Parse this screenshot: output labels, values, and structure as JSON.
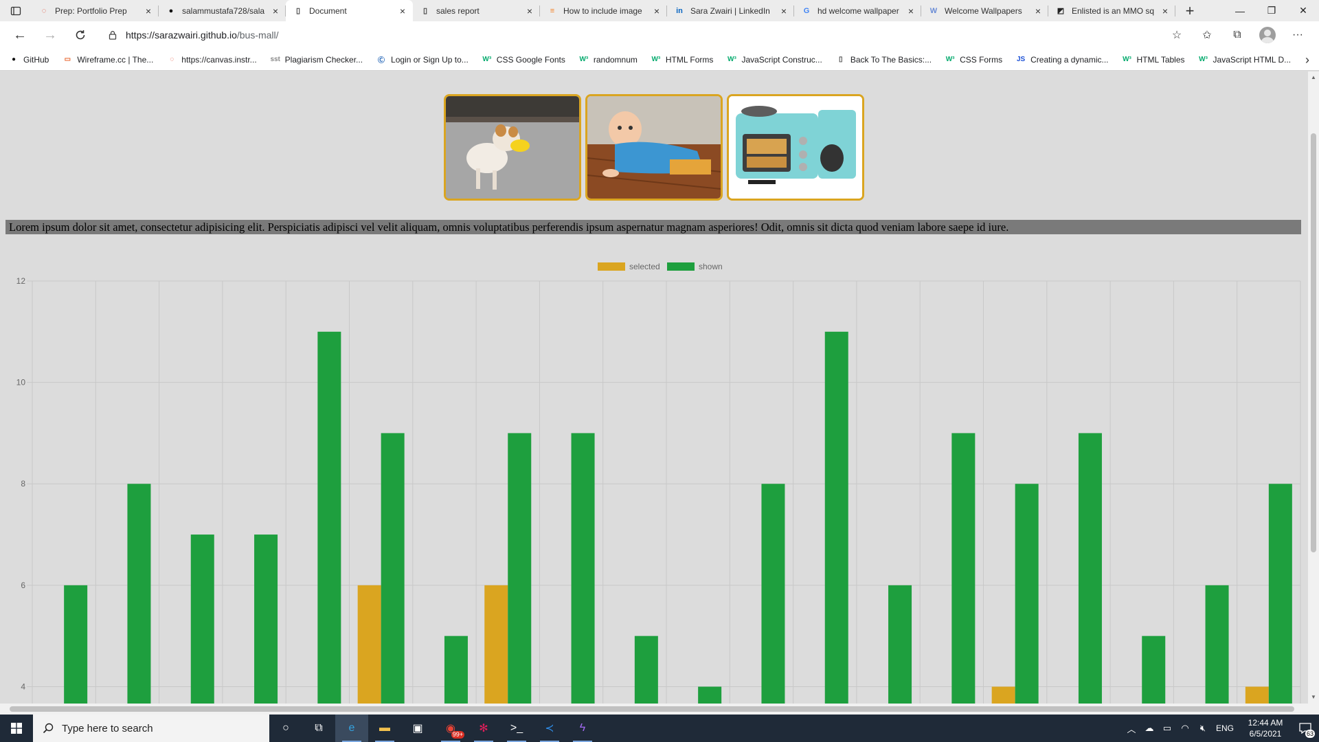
{
  "browser": {
    "tabs": [
      {
        "title": "Prep: Portfolio Prep",
        "icon": "canvas-icon",
        "active": false
      },
      {
        "title": "salammustafa728/sala",
        "icon": "github-icon",
        "active": false
      },
      {
        "title": "Document",
        "icon": "document-icon",
        "active": true
      },
      {
        "title": "sales report",
        "icon": "document-icon",
        "active": false
      },
      {
        "title": "How to include image",
        "icon": "stackoverflow-icon",
        "active": false
      },
      {
        "title": "Sara Zwairi | LinkedIn",
        "icon": "linkedin-icon",
        "active": false
      },
      {
        "title": "hd welcome wallpaper",
        "icon": "google-icon",
        "active": false
      },
      {
        "title": "Welcome Wallpapers",
        "icon": "wallpapers-icon",
        "active": false
      },
      {
        "title": "Enlisted is an MMO sq",
        "icon": "enlisted-icon",
        "active": false
      }
    ],
    "url_host": "https://sarazwairi.github.io",
    "url_path": "/bus-mall/",
    "bookmarks": [
      {
        "label": "GitHub",
        "icon": "github-icon"
      },
      {
        "label": "Wireframe.cc | The...",
        "icon": "wireframe-icon"
      },
      {
        "label": "https://canvas.instr...",
        "icon": "canvas-icon"
      },
      {
        "label": "Plagiarism Checker...",
        "icon": "sst-icon"
      },
      {
        "label": "Login or Sign Up to...",
        "icon": "c-icon"
      },
      {
        "label": "CSS Google Fonts",
        "icon": "w3schools-icon"
      },
      {
        "label": "randomnum",
        "icon": "w3schools-icon"
      },
      {
        "label": "HTML Forms",
        "icon": "w3schools-icon"
      },
      {
        "label": "JavaScript Construc...",
        "icon": "w3schools-icon"
      },
      {
        "label": "Back To The Basics:...",
        "icon": "document-icon"
      },
      {
        "label": "CSS Forms",
        "icon": "w3schools-icon"
      },
      {
        "label": "Creating a dynamic...",
        "icon": "js-icon"
      },
      {
        "label": "HTML Tables",
        "icon": "w3schools-icon"
      },
      {
        "label": "JavaScript HTML D...",
        "icon": "w3schools-icon"
      }
    ]
  },
  "page": {
    "products": [
      {
        "name": "dog-duck",
        "icon": "dog-duck-image"
      },
      {
        "name": "baby-sweep",
        "icon": "baby-sweep-image"
      },
      {
        "name": "breakfast",
        "icon": "breakfast-maker-image"
      }
    ],
    "paragraph": "Lorem ipsum dolor sit amet, consectetur adipisicing elit. Perspiciatis adipisci vel velit aliquam, omnis voluptatibus perferendis ipsum aspernatur magnam asperiores! Odit, omnis sit dicta quod veniam labore saepe id iure."
  },
  "chart_data": {
    "type": "bar",
    "legend": [
      "selected",
      "shown"
    ],
    "legend_position": "top",
    "grid": true,
    "colors": {
      "selected": "#daa520",
      "shown": "#1e9f3e"
    },
    "yticks_visible": [
      12,
      10,
      8,
      6,
      4
    ],
    "ylim_visible": [
      3.6,
      12
    ],
    "series": [
      {
        "name": "selected",
        "values": [
          0,
          0,
          0,
          0,
          0,
          6,
          0,
          6,
          0,
          0,
          0,
          0,
          0,
          0,
          0,
          4,
          0,
          0,
          0,
          4
        ]
      },
      {
        "name": "shown",
        "values": [
          6,
          8,
          7,
          7,
          11,
          9,
          5,
          9,
          9,
          5,
          4,
          8,
          11,
          6,
          9,
          8,
          9,
          5,
          6,
          8
        ]
      }
    ]
  },
  "taskbar": {
    "search_placeholder": "Type here to search",
    "apps": [
      {
        "name": "cortana-icon",
        "glyph": "○"
      },
      {
        "name": "task-view-icon",
        "glyph": "⧉"
      },
      {
        "name": "edge-icon",
        "glyph": "e"
      },
      {
        "name": "file-explorer-icon",
        "glyph": "▬"
      },
      {
        "name": "store-icon",
        "glyph": "▣"
      },
      {
        "name": "chrome-icon",
        "glyph": "◉"
      },
      {
        "name": "slack-icon",
        "glyph": "✻"
      },
      {
        "name": "terminal-icon",
        "glyph": ">_"
      },
      {
        "name": "vscode-icon",
        "glyph": "≺"
      },
      {
        "name": "messenger-icon",
        "glyph": "ϟ"
      }
    ],
    "chrome_badge": "99+",
    "lang": "ENG",
    "time": "12:44 AM",
    "date": "6/5/2021",
    "notifications": "63"
  }
}
